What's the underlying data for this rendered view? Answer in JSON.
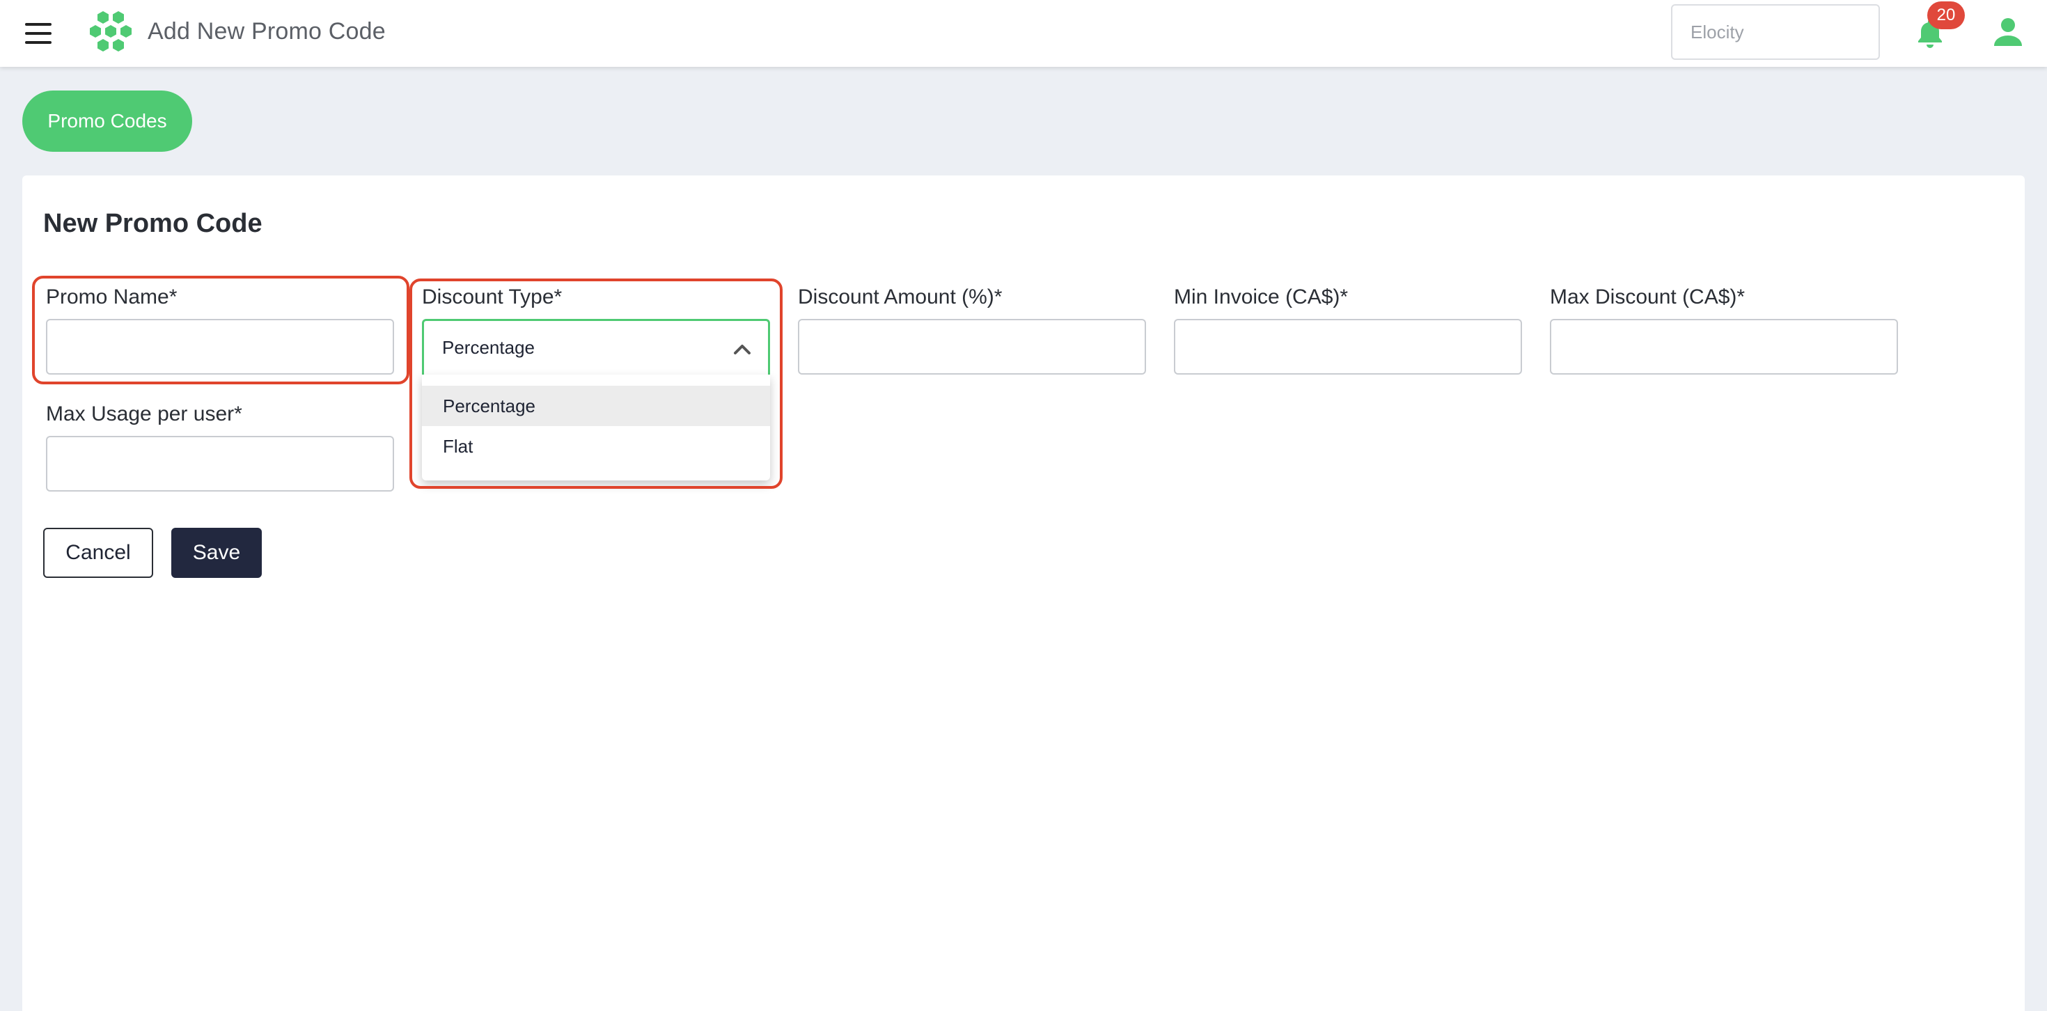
{
  "header": {
    "title": "Add New Promo Code",
    "org_selector_value": "Elocity",
    "notification_count": "20"
  },
  "nav": {
    "promo_codes_label": "Promo Codes"
  },
  "form": {
    "title": "New Promo Code",
    "promo_name_label": "Promo Name*",
    "promo_name_value": "",
    "discount_type_label": "Discount Type*",
    "discount_type_value": "Percentage",
    "discount_type_options": [
      "Percentage",
      "Flat"
    ],
    "discount_amount_label": "Discount Amount (%)*",
    "min_invoice_label": "Min Invoice (CA$)*",
    "max_discount_label": "Max Discount (CA$)*",
    "max_usage_label": "Max Usage per user*",
    "cancel_label": "Cancel",
    "save_label": "Save"
  },
  "icons": {
    "menu": "hamburger-menu-icon",
    "logo": "hexagon-cluster-logo-icon",
    "bell": "bell-icon",
    "user": "user-icon",
    "chevron": "chevron-up-icon"
  },
  "colors": {
    "brand_green": "#4fca73",
    "primary_dark": "#22283f",
    "highlight_red": "#e0442c",
    "badge_red": "#e0483b",
    "background": "#eceff4"
  }
}
